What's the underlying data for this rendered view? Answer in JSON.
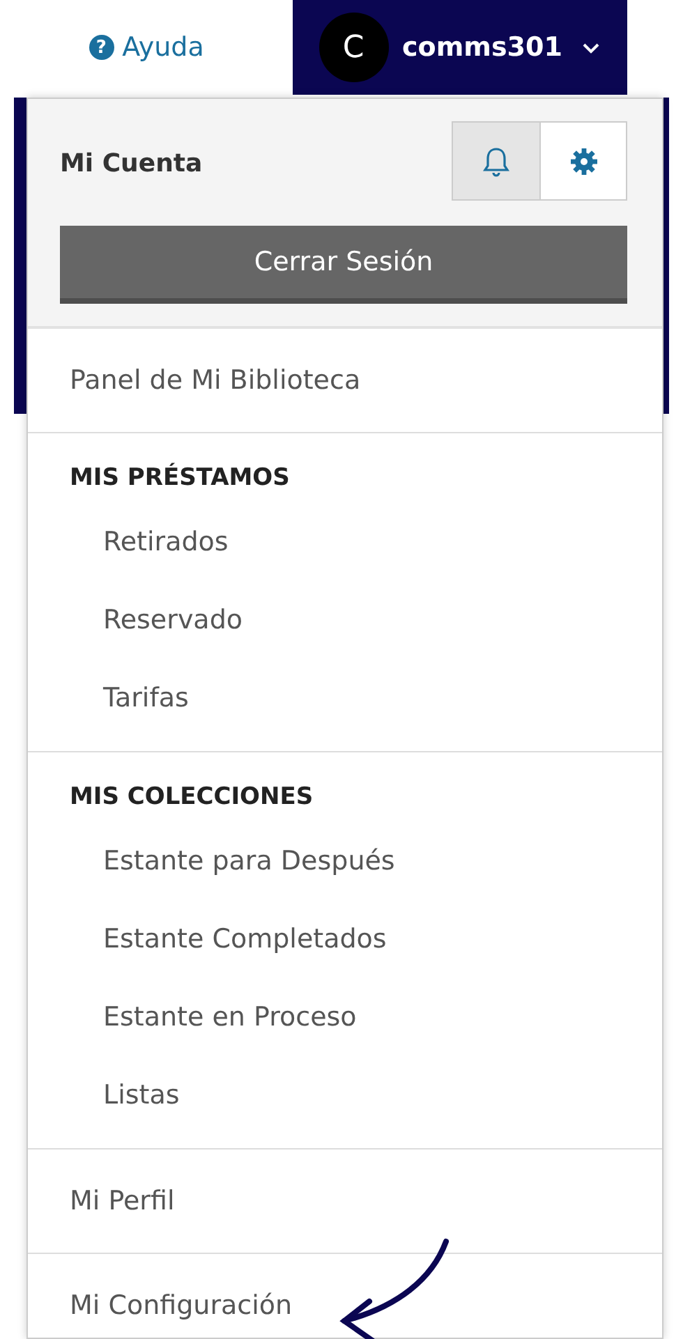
{
  "topbar": {
    "help": {
      "icon_text": "?",
      "label": "Ayuda"
    },
    "user": {
      "avatar": "C",
      "name": "comms301",
      "expanded": true
    }
  },
  "menu": {
    "title": "Mi Cuenta",
    "toggles": [
      {
        "kind": "bell",
        "selected": true
      },
      {
        "kind": "gear",
        "selected": false
      }
    ],
    "logout": "Cerrar Sesión",
    "sections": [
      {
        "kind": "link",
        "label": "Panel de Mi Biblioteca"
      },
      {
        "kind": "group",
        "heading": "MIS PRÉSTAMOS",
        "items": [
          "Retirados",
          "Reservado",
          "Tarifas"
        ]
      },
      {
        "kind": "group",
        "heading": "MIS COLECCIONES",
        "items": [
          "Estante para Después",
          "Estante Completados",
          "Estante en Proceso",
          "Listas"
        ]
      },
      {
        "kind": "link",
        "label": "Mi Perfil"
      },
      {
        "kind": "link",
        "label": "Mi Configuración"
      }
    ]
  }
}
